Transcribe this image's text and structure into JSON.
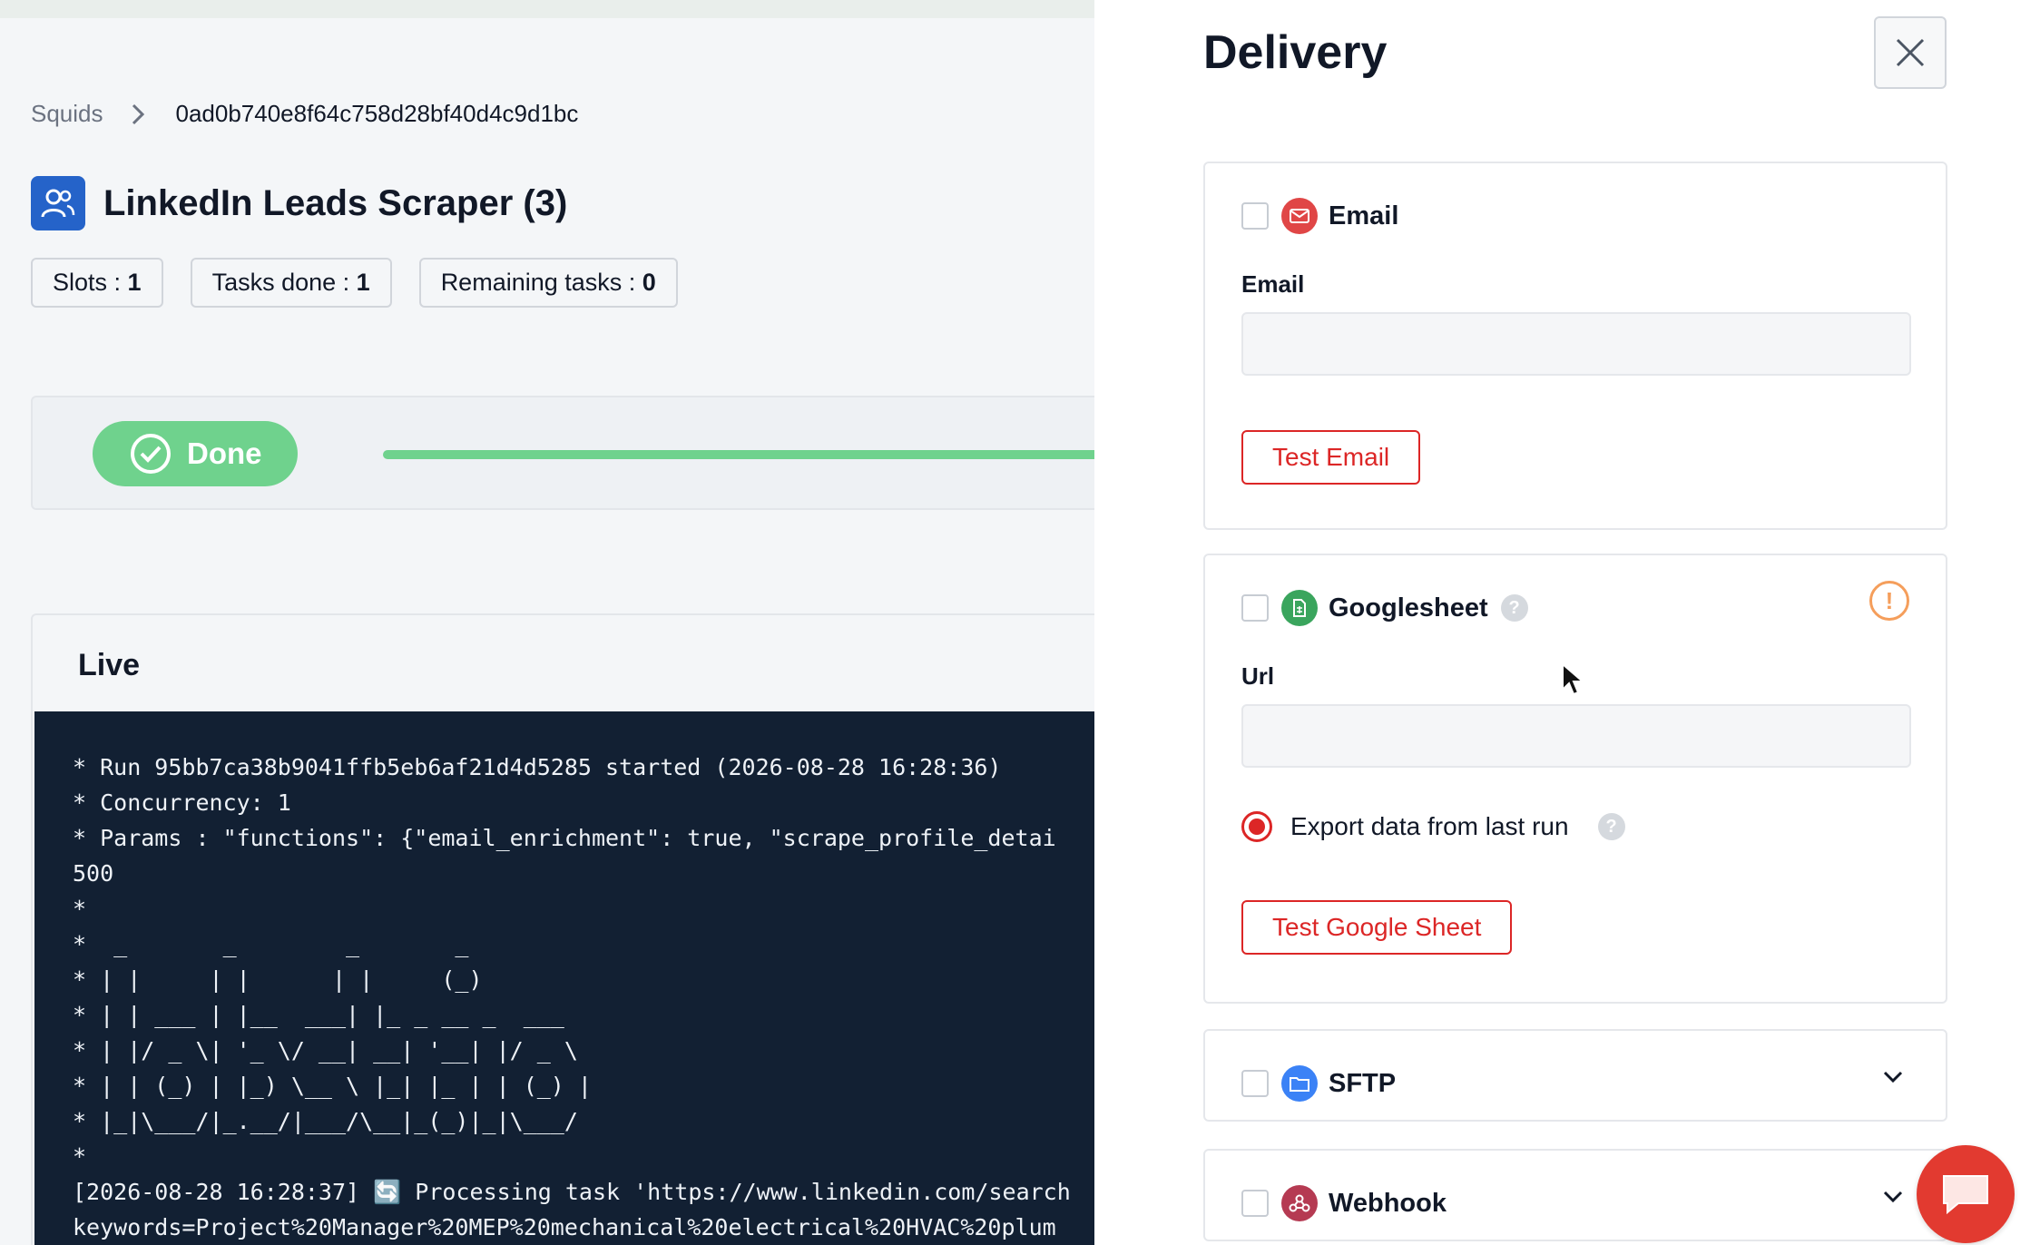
{
  "breadcrumb": {
    "root": "Squids",
    "current": "0ad0b740e8f64c758d28bf40d4c9d1bc"
  },
  "page": {
    "title": "LinkedIn Leads Scraper (3)",
    "icon": "users-icon"
  },
  "stats": {
    "slots_label": "Slots : ",
    "slots_value": "1",
    "tasks_done_label": "Tasks done : ",
    "tasks_done_value": "1",
    "remaining_label": "Remaining tasks : ",
    "remaining_value": "0"
  },
  "status": {
    "label": "Done",
    "progress_fraction": 1.0,
    "color": "#6fd28d"
  },
  "live": {
    "title": "Live",
    "log": "* Run 95bb7ca38b9041ffb5eb6af21d4d5285 started (2026-08-28 16:28:36)\n* Concurrency: 1\n* Params : \"functions\": {\"email_enrichment\": true, \"scrape_profile_detai\n500\n*\n*  _       _        _       _\n* | |     | |      | |     (_)\n* | | ___ | |__  ___| |_ _ __ _  ___\n* | |/ _ \\| '_ \\/ __| __| '__| |/ _ \\\n* | | (_) | |_) \\__ \\ |_| |_ | | (_) |\n* |_|\\___/|_.__/|___/\\__|_(_)|_|\\___/\n*\n[2026-08-28 16:28:37] 🔄 Processing task 'https://www.linkedin.com/search\nkeywords=Project%20Manager%20MEP%20mechanical%20electrical%20HVAC%20plum"
  },
  "drawer": {
    "title": "Delivery",
    "email": {
      "label": "Email",
      "field_label": "Email",
      "value": "",
      "button": "Test Email",
      "icon_color": "#e04646"
    },
    "googlesheet": {
      "label": "Googlesheet",
      "help": "?",
      "warning": "!",
      "field_label": "Url",
      "value": "",
      "radio_label": "Export data from last run",
      "radio_help": "?",
      "button": "Test Google Sheet",
      "icon_color": "#3aa55d"
    },
    "sftp": {
      "label": "SFTP",
      "icon_color": "#3b82f6"
    },
    "webhook": {
      "label": "Webhook",
      "icon_color": "#b53a52"
    }
  },
  "colors": {
    "accent_red": "#dc2626",
    "terminal_bg": "#122033",
    "brand_blue": "#2563c9"
  }
}
